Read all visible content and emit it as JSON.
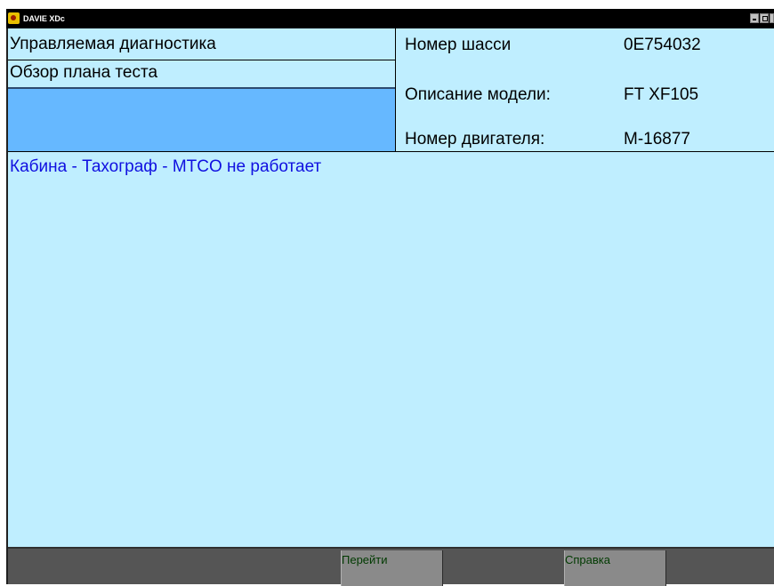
{
  "window": {
    "title": "DAVIE XDc"
  },
  "header": {
    "left": {
      "guided_diagnostics": "Управляемая диагностика",
      "test_plan_overview": "Обзор плана теста"
    },
    "vehicle": {
      "chassis_label": "Номер шасси",
      "chassis_value": "0E754032",
      "model_label": "Описание модели:",
      "model_value": "FT XF105",
      "engine_label": "Номер двигателя:",
      "engine_value": "M-16877"
    }
  },
  "main": {
    "symptom": "Кабина - Тахограф - MTCO не работает"
  },
  "bottombar": {
    "goto_label": "Перейти",
    "help_label": "Справка"
  },
  "colors": {
    "panel_background": "#bfeeff",
    "selected_row": "#66b8ff",
    "symptom_text": "#1010e0",
    "bottombar": "#555555",
    "function_key": "#8a8a8a"
  }
}
